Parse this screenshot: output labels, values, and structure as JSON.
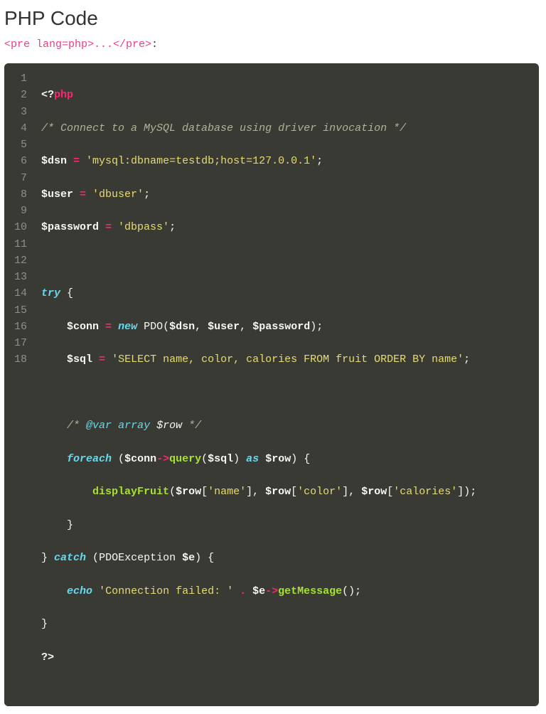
{
  "heading": "PHP Code",
  "pretag": "<pre lang=php>...</pre>",
  "colon": ":",
  "lines": {
    "l1_open": "<?",
    "l1_php": "php",
    "l2": "/* Connect to a MySQL database using driver invocation */",
    "l3_v": "$dsn",
    "l3_eq": " = ",
    "l3_s": "'mysql:dbname=testdb;host=127.0.0.1'",
    "l3_p": ";",
    "l4_v": "$user",
    "l4_eq": " = ",
    "l4_s": "'dbuser'",
    "l4_p": ";",
    "l5_v": "$password",
    "l5_eq": " = ",
    "l5_s": "'dbpass'",
    "l5_p": ";",
    "l7_try": "try",
    "l7_b": " {",
    "l8_v": "$conn",
    "l8_eq": " = ",
    "l8_new": "new",
    "l8_sp": " ",
    "l8_cls": "PDO",
    "l8_p1": "(",
    "l8_a1": "$dsn",
    "l8_c1": ", ",
    "l8_a2": "$user",
    "l8_c2": ", ",
    "l8_a3": "$password",
    "l8_p2": ");",
    "l9_v": "$sql",
    "l9_eq": " = ",
    "l9_s": "'SELECT name, color, calories FROM fruit ORDER BY name'",
    "l9_p": ";",
    "l11_c1": "/* ",
    "l11_tag": "@var",
    "l11_sp": " ",
    "l11_type": "array",
    "l11_sp2": " ",
    "l11_var": "$row",
    "l11_c2": " */",
    "l12_fe": "foreach",
    "l12_p1": " (",
    "l12_v1": "$conn",
    "l12_ar": "->",
    "l12_fn": "query",
    "l12_p2": "(",
    "l12_v2": "$sql",
    "l12_p3": ") ",
    "l12_as": "as",
    "l12_sp": " ",
    "l12_v3": "$row",
    "l12_p4": ") {",
    "l13_fn": "displayFruit",
    "l13_p1": "(",
    "l13_v1": "$row",
    "l13_b1": "[",
    "l13_s1": "'name'",
    "l13_b2": "], ",
    "l13_v2": "$row",
    "l13_b3": "[",
    "l13_s2": "'color'",
    "l13_b4": "], ",
    "l13_v3": "$row",
    "l13_b5": "[",
    "l13_s3": "'calories'",
    "l13_b6": "]);",
    "l14": "    }",
    "l15_b1": "} ",
    "l15_catch": "catch",
    "l15_p1": " (",
    "l15_cls": "PDOException ",
    "l15_v": "$e",
    "l15_p2": ") {",
    "l16_echo": "echo",
    "l16_sp": " ",
    "l16_s": "'Connection failed: '",
    "l16_dot": " . ",
    "l16_v": "$e",
    "l16_ar": "->",
    "l16_fn": "getMessage",
    "l16_p": "();",
    "l17": "}",
    "l18_close": "?>"
  },
  "lineNumbers": [
    "1",
    "2",
    "3",
    "4",
    "5",
    "6",
    "7",
    "8",
    "9",
    "10",
    "11",
    "12",
    "13",
    "14",
    "15",
    "16",
    "17",
    "18"
  ]
}
